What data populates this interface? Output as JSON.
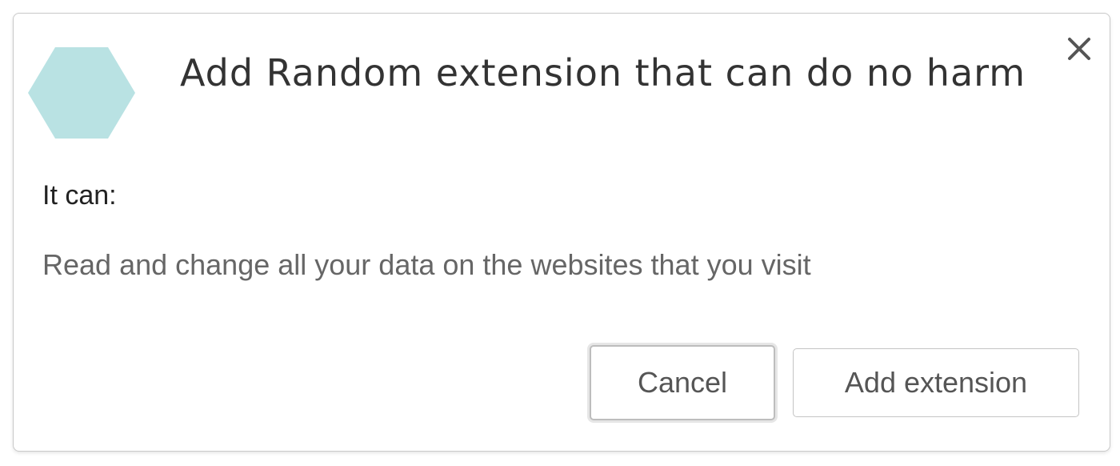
{
  "dialog": {
    "title": "Add Random extension that can do no harm",
    "icon": "hexagon-extension-icon",
    "icon_color": "#b9e2e3",
    "close_icon": "close-icon",
    "section_heading": "It can:",
    "permissions": [
      "Read and change all your data on the websites that you visit"
    ],
    "buttons": {
      "cancel_label": "Cancel",
      "add_label": "Add extension"
    }
  }
}
